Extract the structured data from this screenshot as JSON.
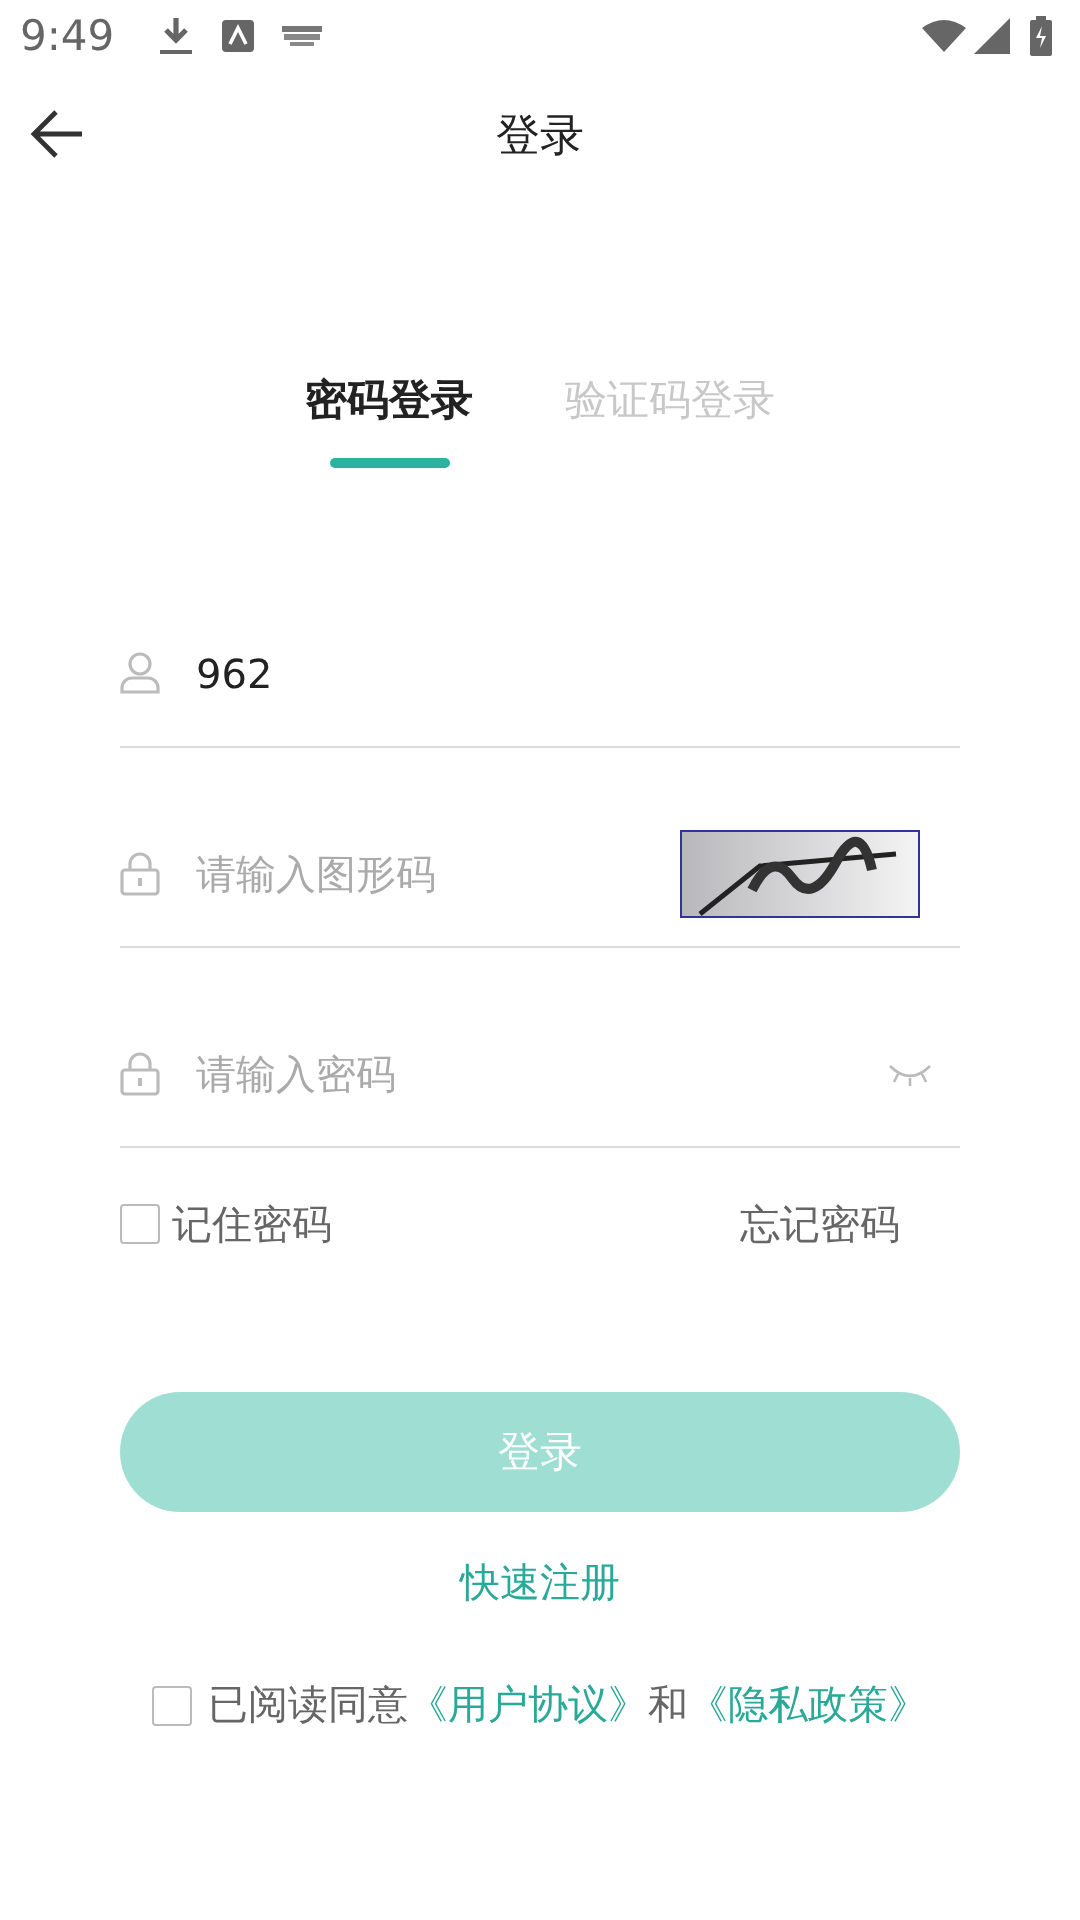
{
  "status_bar": {
    "time": "9:49"
  },
  "header": {
    "title": "登录"
  },
  "tabs": [
    {
      "label": "密码登录",
      "selected": true
    },
    {
      "label": "验证码登录",
      "selected": false
    }
  ],
  "fields": [
    {
      "kind": "account",
      "value": "962"
    },
    {
      "kind": "captcha",
      "placeholder": "请输入图形码"
    },
    {
      "kind": "password",
      "placeholder": "请输入密码"
    }
  ],
  "remember": {
    "label": "记住密码",
    "checked": false
  },
  "forgot": "忘记密码",
  "login_button": {
    "label": "登录",
    "disabled": true
  },
  "register_link": "快速注册",
  "agreement": {
    "checked": false,
    "text": "已阅读同意",
    "links": [
      "《用户协议》",
      "《隐私政策》"
    ],
    "joiner": "和"
  }
}
